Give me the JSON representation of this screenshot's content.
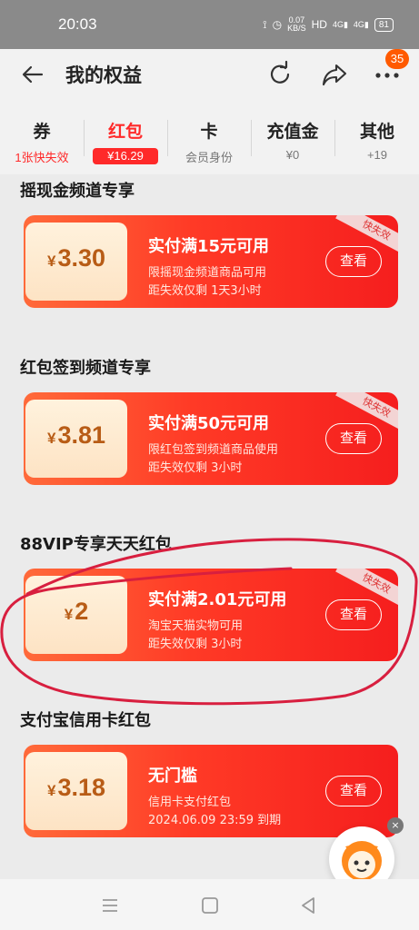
{
  "status": {
    "time": "20:03",
    "net_speed": "0.07",
    "net_unit": "KB/S",
    "hd": "HD",
    "sig1": "4G",
    "sig2": "4G",
    "battery": "81"
  },
  "header": {
    "title": "我的权益",
    "badge": "35"
  },
  "tabs": [
    {
      "label": "券",
      "sub": "1张快失效"
    },
    {
      "label": "红包",
      "sub": "¥16.29"
    },
    {
      "label": "卡",
      "sub": "会员身份"
    },
    {
      "label": "充值金",
      "sub": "¥0"
    },
    {
      "label": "其他",
      "sub": "+19"
    }
  ],
  "sections": [
    {
      "title": "摇现金频道专享",
      "yen": "¥",
      "amount": "3.30",
      "rule": "实付满15元可用",
      "desc1": "限摇现金频道商品可用",
      "desc2": "距失效仅剩 1天3小时",
      "button": "查看",
      "ribbon": "快失效"
    },
    {
      "title": "红包签到频道专享",
      "yen": "¥",
      "amount": "3.81",
      "rule": "实付满50元可用",
      "desc1": "限红包签到频道商品使用",
      "desc2": "距失效仅剩 3小时",
      "button": "查看",
      "ribbon": "快失效"
    },
    {
      "title": "88VIP专享天天红包",
      "yen": "¥",
      "amount": "2",
      "rule": "实付满2.01元可用",
      "desc1": "淘宝天猫实物可用",
      "desc2": "距失效仅剩 3小时",
      "button": "查看",
      "ribbon": "快失效"
    },
    {
      "title": "支付宝信用卡红包",
      "yen": "¥",
      "amount": "3.18",
      "rule": "无门槛",
      "desc1": "信用卡支付红包",
      "desc2": "2024.06.09 23:59 到期",
      "button": "查看"
    }
  ],
  "colors": {
    "accent": "#ff2a2a",
    "card_start": "#ff6a3a",
    "card_end": "#f51e1e",
    "amount": "#b85c16",
    "highlight": "#d81f3f"
  }
}
